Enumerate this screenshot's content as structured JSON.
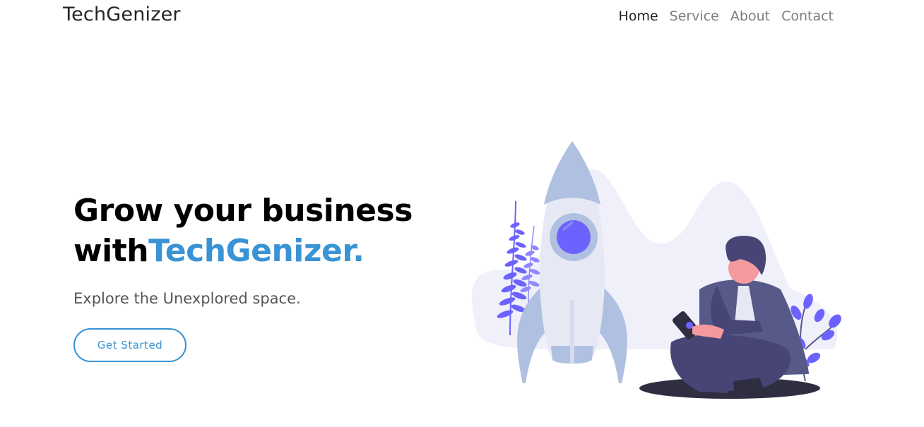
{
  "navbar": {
    "brand": "TechGenizer",
    "links": [
      {
        "label": "Home",
        "active": true
      },
      {
        "label": "Service",
        "active": false
      },
      {
        "label": "About",
        "active": false
      },
      {
        "label": "Contact",
        "active": false
      }
    ]
  },
  "hero": {
    "headline_line1": "Grow your business",
    "headline_prefix": "with",
    "headline_brand": "TechGenizer.",
    "tagline": "Explore the Unexplored space.",
    "cta_label": "Get Started"
  },
  "illustration": {
    "icons": [
      "rocket-icon",
      "person-with-phone-icon",
      "fern-plant-icon",
      "leaf-plant-icon"
    ]
  },
  "colors": {
    "accent": "#3993d4",
    "rocket": "#b0c0e0",
    "purple": "#6c63ff",
    "suit": "#575a89"
  }
}
